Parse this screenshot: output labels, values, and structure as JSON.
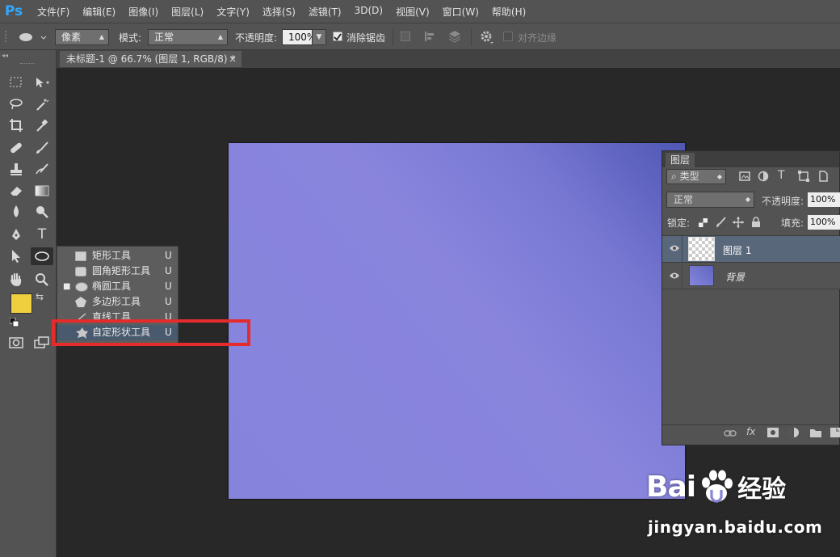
{
  "menubar": {
    "logo": "Ps",
    "items": [
      "文件(F)",
      "编辑(E)",
      "图像(I)",
      "图层(L)",
      "文字(Y)",
      "选择(S)",
      "滤镜(T)",
      "3D(D)",
      "视图(V)",
      "窗口(W)",
      "帮助(H)"
    ]
  },
  "options": {
    "unit_value": "像素",
    "mode_label": "模式:",
    "mode_value": "正常",
    "opacity_label": "不透明度:",
    "opacity_value": "100%",
    "antialias_label": "消除锯齿",
    "align_edges_label": "对齐边缘"
  },
  "document": {
    "tab_title": "未标题-1 @ 66.7% (图层 1, RGB/8) *",
    "close_glyph": "×",
    "canvas_colors": [
      "#4f57b4",
      "#8583dc"
    ]
  },
  "toolbox": {
    "type_tool_glyph": "T",
    "foreground_color": "#f0cf3e",
    "background_color": "#ffffff"
  },
  "flyout": {
    "items": [
      {
        "label": "矩形工具",
        "key": "U",
        "selected": false
      },
      {
        "label": "圆角矩形工具",
        "key": "U",
        "selected": false
      },
      {
        "label": "椭圆工具",
        "key": "U",
        "selected": true
      },
      {
        "label": "多边形工具",
        "key": "U",
        "selected": false
      },
      {
        "label": "直线工具",
        "key": "U",
        "selected": false
      },
      {
        "label": "自定形状工具",
        "key": "U",
        "selected": false
      }
    ],
    "highlight_color": "#e52b2b"
  },
  "layers_panel": {
    "tab_label": "图层",
    "filter_label": "类型",
    "blend_mode": "正常",
    "opacity_label": "不透明度:",
    "opacity_value": "100%",
    "lock_label": "锁定:",
    "fill_label": "填充:",
    "fill_value": "100%",
    "layers": [
      {
        "name": "图层 1",
        "selected": true
      },
      {
        "name": "背景",
        "selected": false
      }
    ],
    "footer_fx": "fx"
  },
  "watermark": {
    "brand_left": "Bai",
    "brand_right": "经验",
    "url": "jingyan.baidu.com"
  }
}
